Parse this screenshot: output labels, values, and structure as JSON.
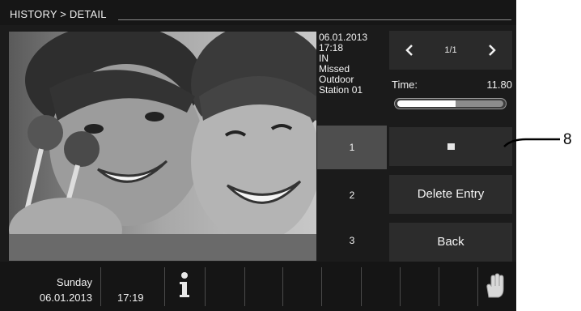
{
  "header": {
    "title": "HISTORY > DETAIL"
  },
  "entry": {
    "date": "06.01.2013",
    "time": "17:18",
    "direction": "IN",
    "status": "Missed",
    "source_line1": "Outdoor",
    "source_line2": "Station 01"
  },
  "pager": {
    "prev_label": "‹",
    "next_label": "›",
    "page": "1/1"
  },
  "playback": {
    "time_label": "Time:",
    "time_value": "11.80",
    "progress": 0.55
  },
  "image_buttons": [
    "1",
    "2",
    "3"
  ],
  "actions": {
    "delete_label": "Delete Entry",
    "back_label": "Back"
  },
  "status_bar": {
    "day": "Sunday",
    "date": "06.01.2013",
    "clock": "17:19"
  },
  "callout": {
    "number": "8"
  }
}
